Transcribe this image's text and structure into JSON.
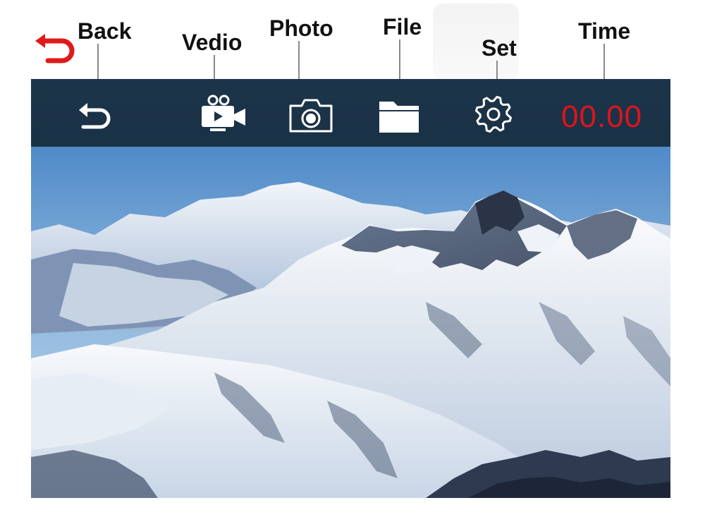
{
  "labels": {
    "back": "Back",
    "video": "Vedio",
    "photo": "Photo",
    "file": "File",
    "set": "Set",
    "time": "Time"
  },
  "toolbar": {
    "time_value": "00.00",
    "time_color": "#e0141b",
    "background": "#1b3247",
    "icons": [
      "back-arrow-icon",
      "video-camera-icon",
      "camera-icon",
      "folder-icon",
      "gear-icon"
    ]
  },
  "preview": {
    "subject": "snow-covered mountain range under blue sky"
  }
}
